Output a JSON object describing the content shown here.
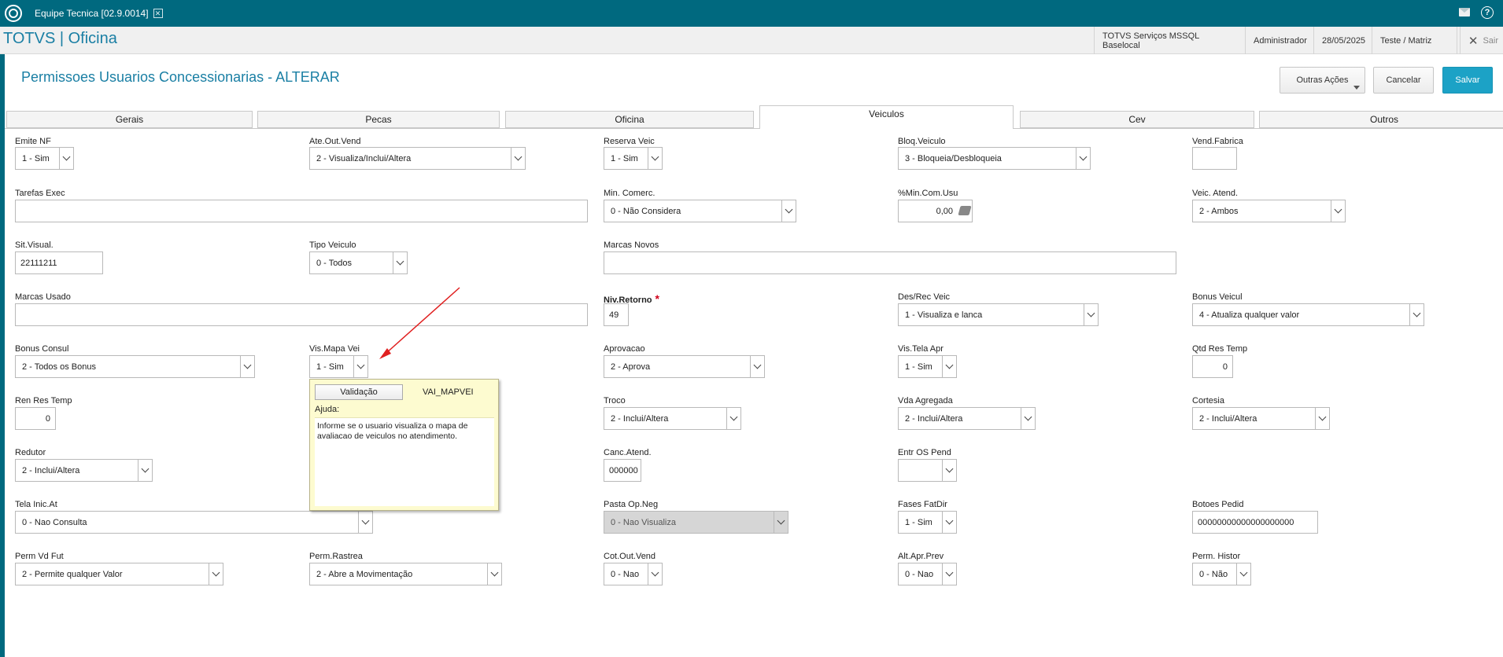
{
  "titlebar": {
    "tab_title": "Equipe Tecnica [02.9.0014]",
    "close_glyph": "✕",
    "help_glyph": "?"
  },
  "header": {
    "app_title": "TOTVS | Oficina",
    "environment": "TOTVS Serviços MSSQL Baselocal",
    "user": "Administrador",
    "date": "28/05/2025",
    "branch": "Teste / Matriz",
    "logout": "Sair",
    "logout_glyph": "✕"
  },
  "page": {
    "title": "Permissoes Usuarios Concessionarias - ALTERAR"
  },
  "actions": {
    "other_actions": "Outras Ações",
    "cancel": "Cancelar",
    "save": "Salvar"
  },
  "tabs": [
    {
      "label": "Gerais"
    },
    {
      "label": "Pecas"
    },
    {
      "label": "Oficina"
    },
    {
      "label": "Veiculos",
      "active": true
    },
    {
      "label": "Cev"
    },
    {
      "label": "Outros"
    }
  ],
  "fields": {
    "emite_nf": {
      "label": "Emite NF",
      "value": "1 - Sim"
    },
    "ate_out_vend": {
      "label": "Ate.Out.Vend",
      "value": "2 - Visualiza/Inclui/Altera"
    },
    "reserva_veic": {
      "label": "Reserva Veic",
      "value": "1 - Sim"
    },
    "bloq_veiculo": {
      "label": "Bloq.Veiculo",
      "value": "3 - Bloqueia/Desbloqueia"
    },
    "vend_fabrica": {
      "label": "Vend.Fabrica",
      "value": ""
    },
    "tarefas_exec": {
      "label": "Tarefas Exec",
      "value": ""
    },
    "min_comerc": {
      "label": "Min. Comerc.",
      "value": "0 - Não Considera"
    },
    "min_com_usu": {
      "label": "%Min.Com.Usu",
      "value": "0,00"
    },
    "veic_atend": {
      "label": "Veic. Atend.",
      "value": "2 - Ambos"
    },
    "sit_visual": {
      "label": "Sit.Visual.",
      "value": "22111211"
    },
    "tipo_veiculo": {
      "label": "Tipo Veiculo",
      "value": "0 - Todos"
    },
    "marcas_novos": {
      "label": "Marcas Novos",
      "value": ""
    },
    "marcas_usado": {
      "label": "Marcas Usado",
      "value": ""
    },
    "niv_retorno": {
      "label": "Niv.Retorno",
      "required_mark": "*",
      "value": "49"
    },
    "des_rec_veic": {
      "label": "Des/Rec Veic",
      "value": "1 - Visualiza e lanca"
    },
    "bonus_veicul": {
      "label": "Bonus Veicul",
      "value": "4 - Atualiza qualquer valor"
    },
    "bonus_consul": {
      "label": "Bonus Consul",
      "value": "2 - Todos os Bonus"
    },
    "vis_mapa_vei": {
      "label": "Vis.Mapa Vei",
      "value": "1 - Sim"
    },
    "aprovacao": {
      "label": "Aprovacao",
      "value": "2 - Aprova"
    },
    "vis_tela_apr": {
      "label": "Vis.Tela Apr",
      "value": "1 - Sim"
    },
    "qtd_res_temp": {
      "label": "Qtd Res Temp",
      "value": "0"
    },
    "ren_res_temp": {
      "label": "Ren Res Temp",
      "value": "0"
    },
    "troco": {
      "label": "Troco",
      "value": "2 - Inclui/Altera"
    },
    "vda_agregada": {
      "label": "Vda Agregada",
      "value": "2 - Inclui/Altera"
    },
    "cortesia": {
      "label": "Cortesia",
      "value": "2 - Inclui/Altera"
    },
    "redutor": {
      "label": "Redutor",
      "value": "2 - Inclui/Altera"
    },
    "canc_atend": {
      "label": "Canc.Atend.",
      "value": "000000"
    },
    "entr_os_pend": {
      "label": "Entr OS Pend",
      "value": ""
    },
    "tela_inic_at": {
      "label": "Tela Inic.At",
      "value": "0 - Nao Consulta"
    },
    "pasta_op_neg": {
      "label": "Pasta Op.Neg",
      "value": "0 - Nao Visualiza"
    },
    "fases_fatdir": {
      "label": "Fases FatDir",
      "value": "1 - Sim"
    },
    "botoes_pedid": {
      "label": "Botoes Pedid",
      "value": "00000000000000000000"
    },
    "perm_vd_fut": {
      "label": "Perm Vd Fut",
      "value": "2 - Permite qualquer Valor"
    },
    "perm_rastrea": {
      "label": "Perm.Rastrea",
      "value": "2 - Abre a Movimentação"
    },
    "cot_out_vend": {
      "label": "Cot.Out.Vend",
      "value": "0 - Nao"
    },
    "alt_apr_prev": {
      "label": "Alt.Apr.Prev",
      "value": "0 - Nao"
    },
    "perm_histor": {
      "label": "Perm. Histor",
      "value": "0 - Não"
    }
  },
  "tooltip": {
    "validation_button": "Validação",
    "field_code": "VAI_MAPVEI",
    "help_label": "Ajuda:",
    "help_text": "Informe se o usuario visualiza o mapa de avaliacao de veiculos no atendimento."
  },
  "colors": {
    "titlebar": "#00697f",
    "accent_text": "#1a7fa4",
    "primary_button": "#1ca2c6",
    "annotation_arrow": "#e02020"
  }
}
